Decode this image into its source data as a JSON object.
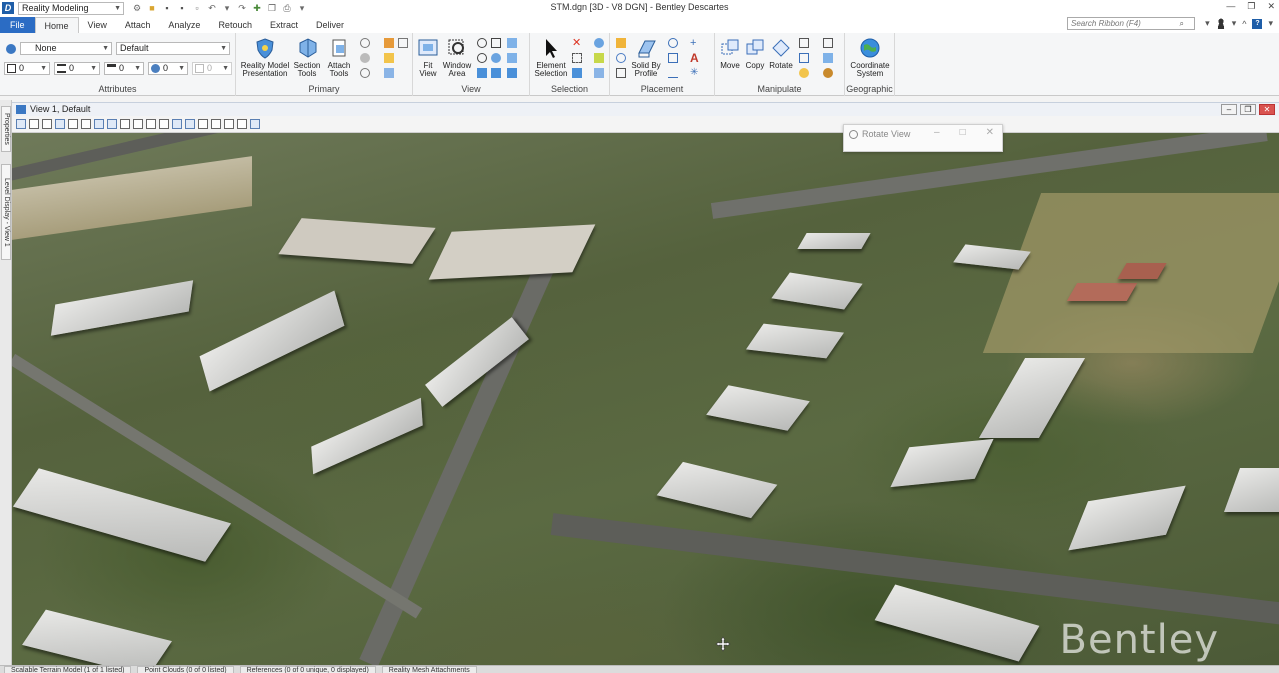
{
  "app": {
    "logo": "D",
    "window_title": "STM.dgn [3D - V8 DGN] - Bentley Descartes",
    "workflow": "Reality Modeling"
  },
  "tabs": [
    {
      "label": "File"
    },
    {
      "label": "Home"
    },
    {
      "label": "View"
    },
    {
      "label": "Attach"
    },
    {
      "label": "Analyze"
    },
    {
      "label": "Retouch"
    },
    {
      "label": "Extract"
    },
    {
      "label": "Deliver"
    }
  ],
  "search": {
    "placeholder": "Search Ribbon (F4)"
  },
  "attributes": {
    "level": "None",
    "style": "Default",
    "color": "0",
    "line_style": "0",
    "line_weight": "0",
    "transparency": "0",
    "priority": "0",
    "label": "Attributes"
  },
  "groups": {
    "primary": {
      "label": "Primary",
      "reality_model": "Reality Model Presentation",
      "section_tools": "Section Tools",
      "attach_tools": "Attach Tools"
    },
    "view": {
      "label": "View",
      "fit_view": "Fit View",
      "window_area": "Window Area"
    },
    "selection": {
      "label": "Selection",
      "element_selection": "Element Selection"
    },
    "placement": {
      "label": "Placement",
      "solid_by_profile": "Solid By Profile"
    },
    "manipulate": {
      "label": "Manipulate",
      "move": "Move",
      "copy": "Copy",
      "rotate": "Rotate"
    },
    "geographic": {
      "label": "Geographic",
      "coordinate_system": "Coordinate System"
    }
  },
  "view_window": {
    "title": "View 1, Default"
  },
  "dock": {
    "properties": "Properties",
    "level_display": "Level Display - View 1"
  },
  "rotate_view": {
    "title": "Rotate View"
  },
  "watermark": "Bentley",
  "status_tabs": [
    "Scalable Terrain Model (1 of 1 listed)",
    "Point Clouds (0 of 0 listed)",
    "References (0 of 0 unique, 0 displayed)",
    "Reality Mesh Attachments"
  ],
  "colors": {
    "file_tab": "#2b6cc4",
    "ribbon_bg": "#f5f6f7",
    "accent_blue": "#1f5ea8"
  }
}
